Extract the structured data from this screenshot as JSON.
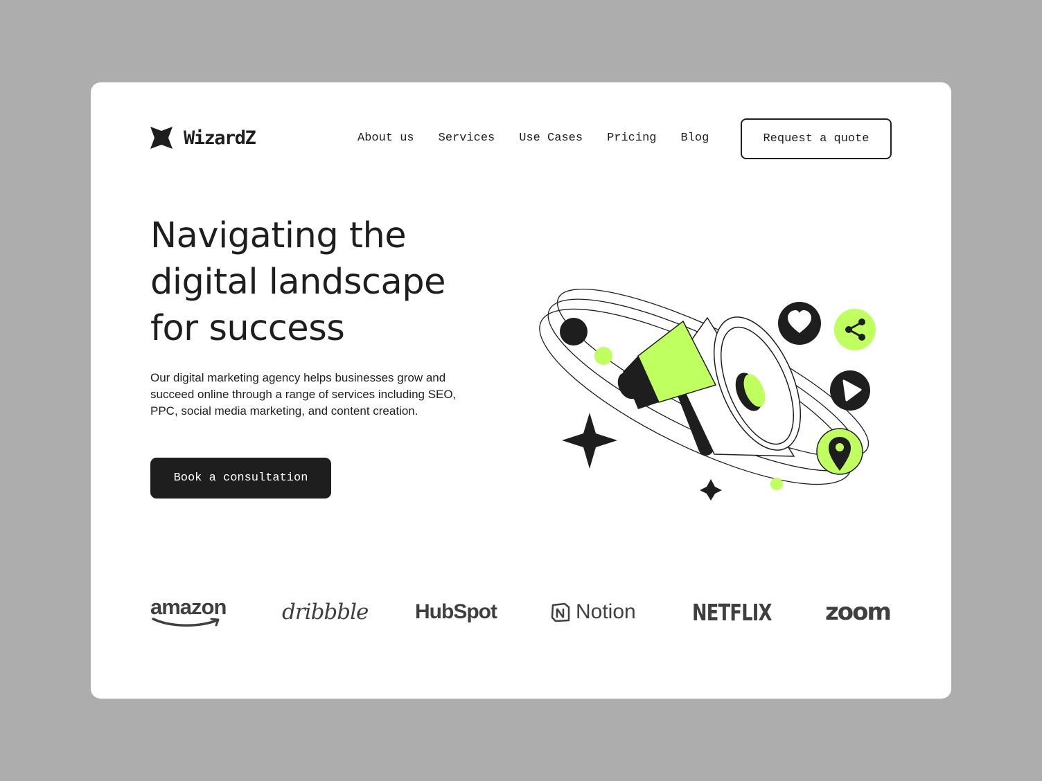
{
  "brand": {
    "name": "WizardZ"
  },
  "nav": {
    "items": [
      "About us",
      "Services",
      "Use Cases",
      "Pricing",
      "Blog"
    ],
    "cta_label": "Request a quote"
  },
  "hero": {
    "title_lines": [
      "Navigating the",
      "digital landscape",
      "for success"
    ],
    "description": "Our digital marketing agency helps businesses grow and succeed online through a range of services including SEO, PPC, social media marketing, and content creation.",
    "cta_label": "Book a consultation"
  },
  "illustration": {
    "icons": [
      "megaphone-icon",
      "heart-icon",
      "share-icon",
      "play-icon",
      "location-pin-icon",
      "sparkle-icon"
    ]
  },
  "clients": {
    "logos": [
      "amazon",
      "dribbble",
      "HubSpot",
      "Notion",
      "NETFLIX",
      "zoom"
    ]
  },
  "colors": {
    "background": "#adadad",
    "card": "#ffffff",
    "ink": "#1e1e1e",
    "accent": "#bfff5f",
    "logo_gray": "#3f3f3f"
  }
}
